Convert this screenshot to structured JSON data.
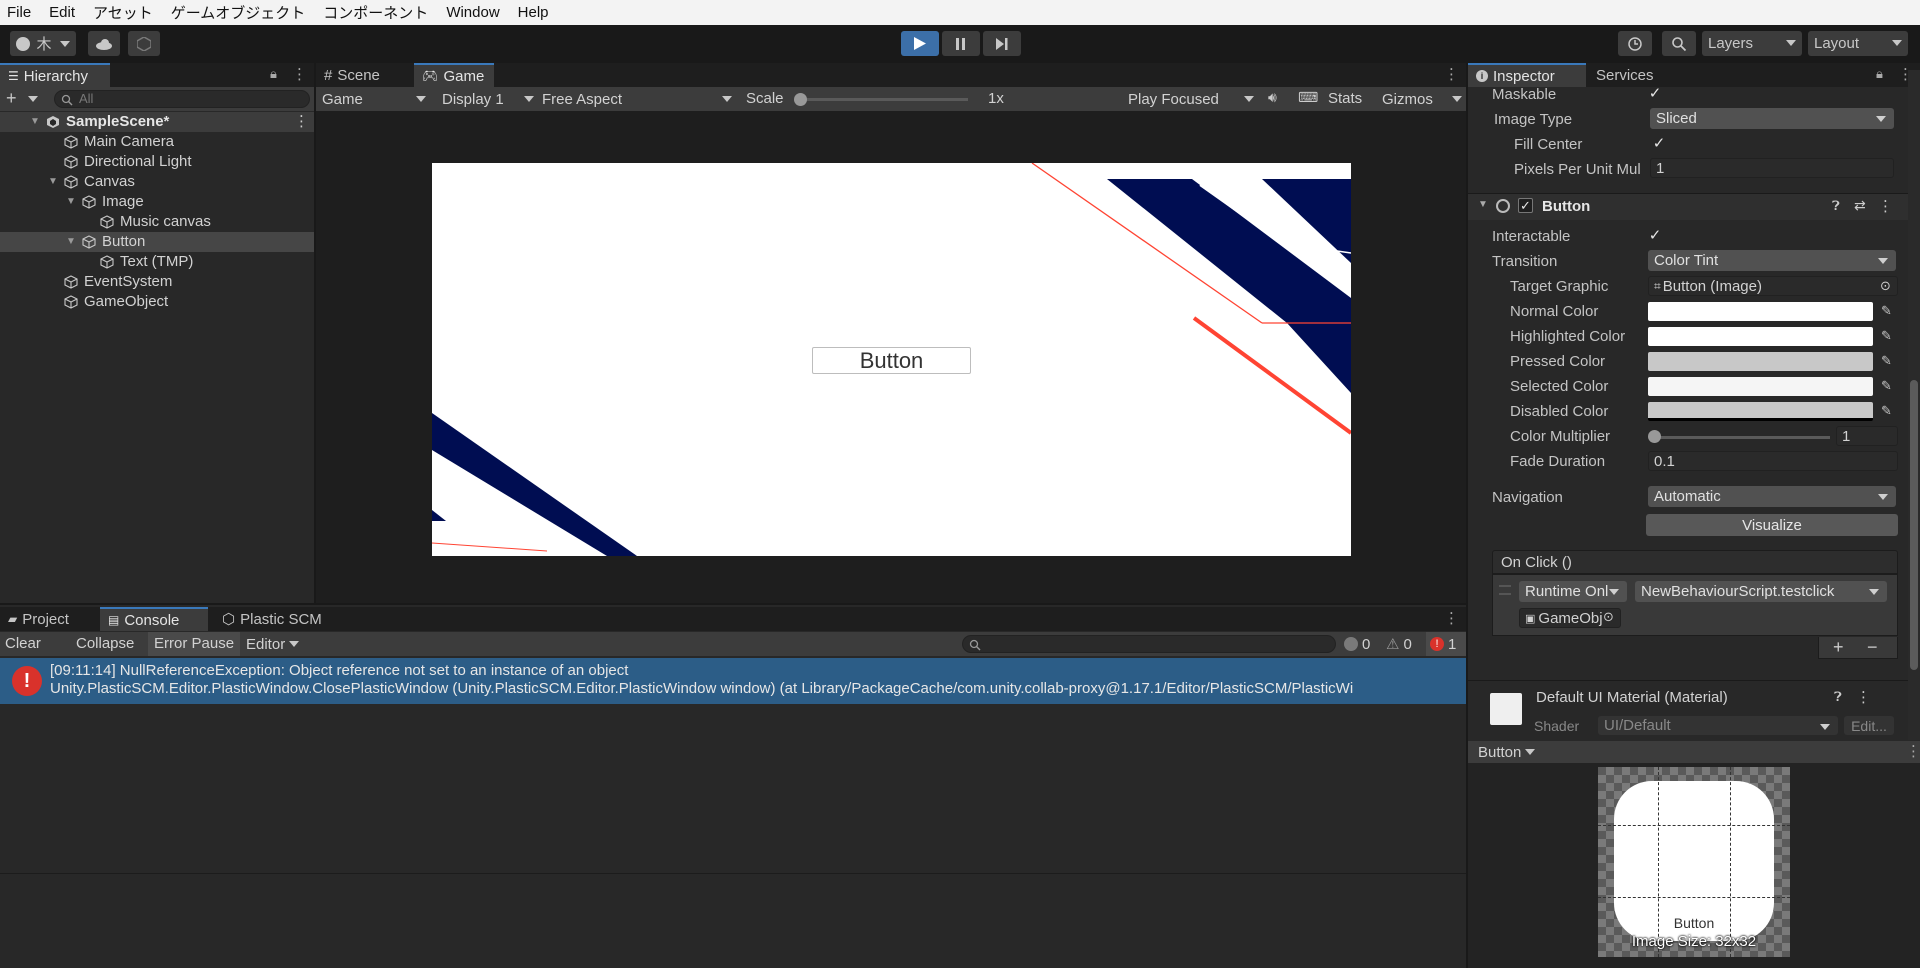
{
  "menu": [
    "File",
    "Edit",
    "アセット",
    "ゲームオブジェクト",
    "コンポーネント",
    "Window",
    "Help"
  ],
  "toolbar": {
    "account_label": "木",
    "layers_label": "Layers",
    "layout_label": "Layout"
  },
  "hierarchy": {
    "tab_label": "Hierarchy",
    "search_placeholder": "All",
    "items": [
      {
        "label": "SampleScene*",
        "depth": 0,
        "kind": "scene",
        "expanded": true
      },
      {
        "label": "Main Camera",
        "depth": 1
      },
      {
        "label": "Directional Light",
        "depth": 1
      },
      {
        "label": "Canvas",
        "depth": 1,
        "expanded": true
      },
      {
        "label": "Image",
        "depth": 2,
        "expanded": true
      },
      {
        "label": "Music canvas",
        "depth": 3
      },
      {
        "label": "Button",
        "depth": 2,
        "expanded": true,
        "selected": true
      },
      {
        "label": "Text (TMP)",
        "depth": 3
      },
      {
        "label": "EventSystem",
        "depth": 1
      },
      {
        "label": "GameObject",
        "depth": 1
      }
    ]
  },
  "center_tabs": {
    "scene": "Scene",
    "game": "Game"
  },
  "game_toolbar": {
    "view": "Game",
    "display": "Display 1",
    "aspect": "Free Aspect",
    "scale_label": "Scale",
    "scale_value": "1x",
    "play_mode": "Play Focused",
    "stats": "Stats",
    "gizmos": "Gizmos"
  },
  "game_view": {
    "button_text": "Button"
  },
  "bottom_tabs": {
    "project": "Project",
    "console": "Console",
    "plastic": "Plastic SCM"
  },
  "console": {
    "clear": "Clear",
    "collapse": "Collapse",
    "error_pause": "Error Pause",
    "editor": "Editor",
    "count_info": "0",
    "count_warn": "0",
    "count_err": "1",
    "message_line1": "[09:11:14] NullReferenceException: Object reference not set to an instance of an object",
    "message_line2": "Unity.PlasticSCM.Editor.PlasticWindow.ClosePlasticWindow (Unity.PlasticSCM.Editor.PlasticWindow window) (at Library/PackageCache/com.unity.collab-proxy@1.17.1/Editor/PlasticSCM/PlasticWi"
  },
  "inspector": {
    "tab_label": "Inspector",
    "services_label": "Services",
    "maskable_label": "Maskable",
    "image_type_label": "Image Type",
    "image_type_value": "Sliced",
    "fill_center_label": "Fill Center",
    "ppu_label": "Pixels Per Unit Mul",
    "ppu_value": "1",
    "button_component": "Button",
    "interactable_label": "Interactable",
    "transition_label": "Transition",
    "transition_value": "Color Tint",
    "target_graphic_label": "Target Graphic",
    "target_graphic_value": "Button (Image)",
    "normal_color_label": "Normal Color",
    "highlighted_color_label": "Highlighted Color",
    "pressed_color_label": "Pressed Color",
    "selected_color_label": "Selected Color",
    "disabled_color_label": "Disabled Color",
    "color_multiplier_label": "Color Multiplier",
    "color_multiplier_value": "1",
    "fade_duration_label": "Fade Duration",
    "fade_duration_value": "0.1",
    "navigation_label": "Navigation",
    "navigation_value": "Automatic",
    "visualize_label": "Visualize",
    "on_click_label": "On Click ()",
    "runtime_value": "Runtime Onl",
    "function_value": "NewBehaviourScript.testclick",
    "object_value": "GameObj",
    "material_name": "Default UI Material (Material)",
    "shader_label": "Shader",
    "shader_value": "UI/Default",
    "edit_label": "Edit...",
    "preview_dropdown": "Button",
    "preview_name": "Button",
    "preview_size": "Image Size: 32x32"
  },
  "colors": {
    "accent": "#3a79bb",
    "play_button": "#3c6fa8",
    "error": "#d9322b",
    "console_selected": "#2c5d87",
    "navy": "#000d52",
    "red_line": "#ff4433"
  }
}
